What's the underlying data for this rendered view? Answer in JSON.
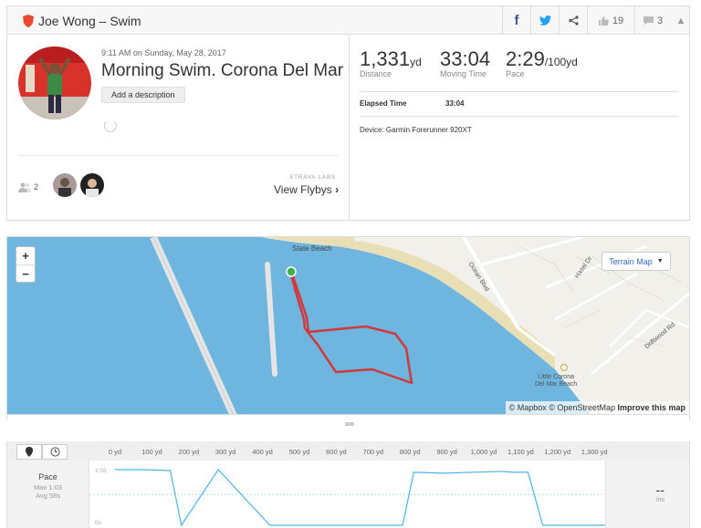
{
  "header": {
    "title": "Joe Wong – Swim",
    "kudos_count": "19",
    "comment_count": "3"
  },
  "activity": {
    "datetime": "9:11 AM on Sunday, May 28, 2017",
    "name": "Morning Swim. Corona Del Mar",
    "add_description_label": "Add a description"
  },
  "athletes": {
    "count": "2"
  },
  "flyby": {
    "labs_label": "STRAVA LABS",
    "view_label": "View Flybys",
    "arrow": "›"
  },
  "stats": {
    "distance": {
      "value": "1,331",
      "unit": "yd",
      "label": "Distance"
    },
    "moving_time": {
      "value": "33:04",
      "label": "Moving Time"
    },
    "pace": {
      "value": "2:29",
      "unit": "/100yd",
      "label": "Pace"
    },
    "elapsed_label": "Elapsed Time",
    "elapsed_value": "33:04",
    "device": "Device: Garmin Forerunner 920XT"
  },
  "map": {
    "zoom_in": "+",
    "zoom_out": "−",
    "terrain_label": "Terrain Map",
    "place_labels": {
      "beach": "State Beach",
      "road1": "Ocean Blvd",
      "road2": "Hazel Dr",
      "road3": "Driftwood Rd",
      "beach2": "Little Corona\nDel Mar Beach"
    },
    "attribution_mapbox": "© Mapbox",
    "attribution_osm": "© OpenStreetMap",
    "attribution_improve": "Improve this map",
    "colors": {
      "water": "#6eb6e0",
      "land": "#f2f0ea",
      "route": "#d2393a",
      "start": "#3db04a"
    }
  },
  "chart_data": {
    "type": "line",
    "title": "",
    "xlabel": "",
    "ylabel": "Pace",
    "x_ticks": [
      "0 yd",
      "100 yd",
      "200 yd",
      "300 yd",
      "400 yd",
      "500 yd",
      "600 yd",
      "700 yd",
      "800 yd",
      "900 yd",
      "1,000 yd",
      "1,100 yd",
      "1,200 yd",
      "1,300 yd"
    ],
    "y_ticks": [
      "1:03",
      "0s"
    ],
    "series": [
      {
        "x": [
          0,
          70,
          150,
          180,
          280,
          420,
          780,
          810,
          890,
          1050,
          1080,
          1120,
          1160,
          1330
        ],
        "y": [
          63,
          63,
          62,
          0,
          63,
          0,
          0,
          60,
          59,
          61,
          60,
          60,
          0,
          0
        ]
      }
    ],
    "xlim": [
      0,
      1350
    ],
    "ylim": [
      0,
      63
    ]
  },
  "pace_panel": {
    "label": "Pace",
    "max": "Max 1:03",
    "avg": "Avg 58s",
    "value": "--",
    "unit": "/mi"
  }
}
